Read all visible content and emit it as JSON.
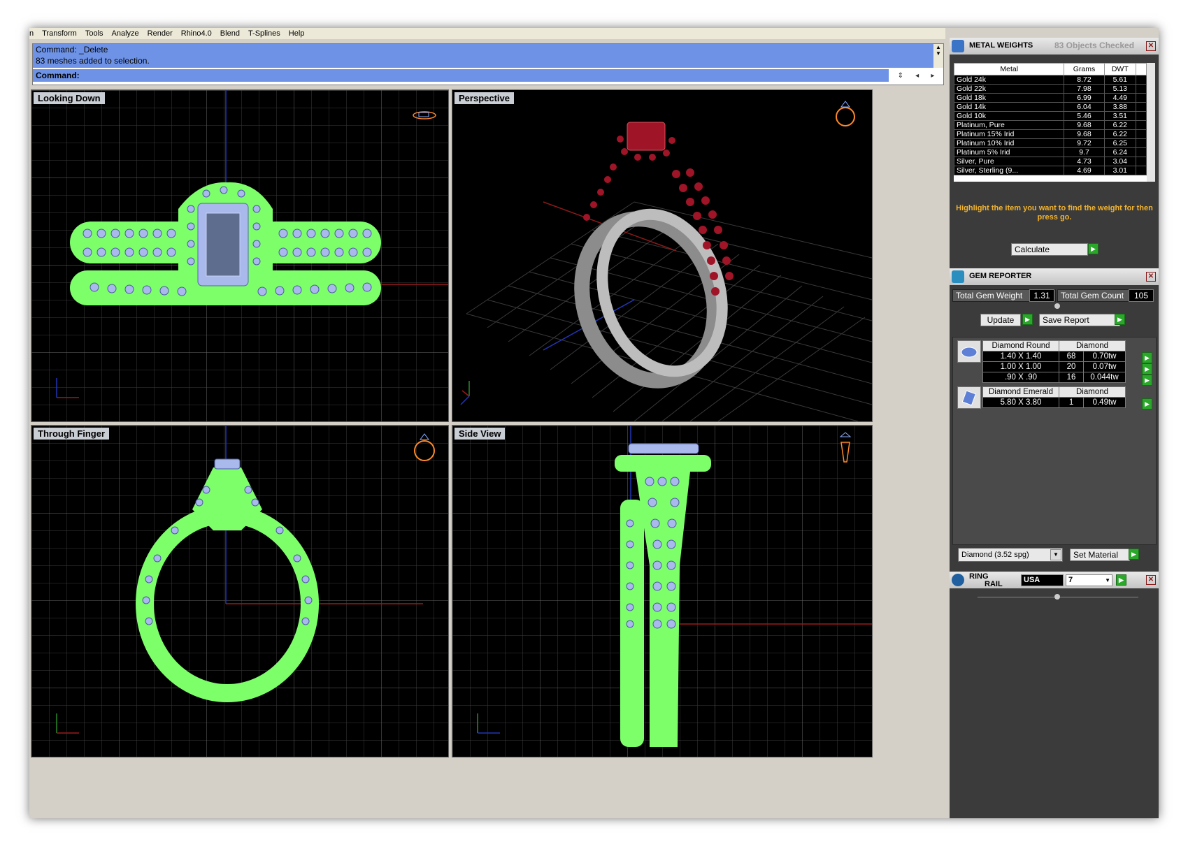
{
  "menu": [
    "n",
    "Transform",
    "Tools",
    "Analyze",
    "Render",
    "Rhino4.0",
    "Blend",
    "T-Splines",
    "Help"
  ],
  "command": {
    "line1": "Command: _Delete",
    "line2": "83 meshes added to selection.",
    "prompt": "Command:"
  },
  "viewports": {
    "top_left": "Looking Down",
    "top_right": "Perspective",
    "bottom_left": "Through Finger",
    "bottom_right": "Side View"
  },
  "metal_weights": {
    "title": "METAL WEIGHTS",
    "status": "83 Objects Checked",
    "headers": [
      "Metal",
      "Grams",
      "DWT"
    ],
    "rows": [
      [
        "Gold 24k",
        "8.72",
        "5.61"
      ],
      [
        "Gold 22k",
        "7.98",
        "5.13"
      ],
      [
        "Gold 18k",
        "6.99",
        "4.49"
      ],
      [
        "Gold 14k",
        "6.04",
        "3.88"
      ],
      [
        "Gold 10k",
        "5.46",
        "3.51"
      ],
      [
        "Platinum, Pure",
        "9.68",
        "6.22"
      ],
      [
        "Platinum 15% Irid",
        "9.68",
        "6.22"
      ],
      [
        "Platinum 10% Irid",
        "9.72",
        "6.25"
      ],
      [
        "Platinum 5% Irid",
        "9.7",
        "6.24"
      ],
      [
        "Silver, Pure",
        "4.73",
        "3.04"
      ],
      [
        "Silver, Sterling (9...",
        "4.69",
        "3.01"
      ]
    ],
    "hint": "Highlight the item you want to find the weight for then press go.",
    "calculate": "Calculate"
  },
  "gem_reporter": {
    "title": "GEM REPORTER",
    "total_weight_label": "Total Gem Weight",
    "total_weight": "1.31",
    "total_count_label": "Total Gem Count",
    "total_count": "105",
    "update": "Update",
    "save_report": "Save Report",
    "group1": {
      "name": "Diamond Round",
      "material": "Diamond",
      "rows": [
        [
          "1.40 X 1.40",
          "68",
          "0.70tw"
        ],
        [
          "1.00 X 1.00",
          "20",
          "0.07tw"
        ],
        [
          ".90 X .90",
          "16",
          "0.044tw"
        ]
      ]
    },
    "group2": {
      "name": "Diamond Emerald",
      "material": "Diamond",
      "rows": [
        [
          "5.80 X 3.80",
          "1",
          "0.49tw"
        ]
      ]
    },
    "material_select": "Diamond     (3.52 spg)",
    "set_material": "Set Material"
  },
  "ring_rail": {
    "title_1": "RING",
    "title_2": "RAIL",
    "country": "USA",
    "size": "7"
  },
  "colors": {
    "command_bg": "#6e93e6",
    "mesh_green": "#7dff6a",
    "gem_blue": "#a9b9ec",
    "ruby": "#a01428",
    "hint_text": "#f2b32d",
    "go_green": "#2aa82a"
  }
}
